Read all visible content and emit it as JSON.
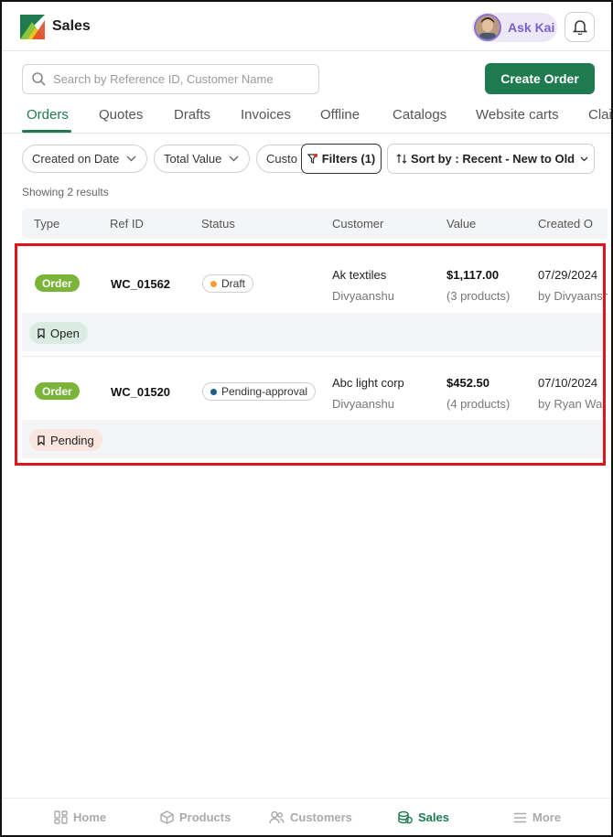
{
  "header": {
    "app_title": "Sales",
    "ask_label": "Ask Kai"
  },
  "search": {
    "placeholder": "Search by Reference ID, Customer Name"
  },
  "create_order_label": "Create Order",
  "tabs": [
    {
      "label": "Orders",
      "active": true
    },
    {
      "label": "Quotes"
    },
    {
      "label": "Drafts"
    },
    {
      "label": "Invoices"
    },
    {
      "label": "Offline"
    },
    {
      "label": "Catalogs"
    },
    {
      "label": "Website carts"
    },
    {
      "label": "Clai"
    }
  ],
  "filters": {
    "created_on_date": "Created on Date",
    "total_value": "Total Value",
    "customer": "Custo",
    "filters_button": "Filters (1)",
    "sort_button": "Sort by : Recent - New to Old"
  },
  "showing": "Showing 2 results",
  "table": {
    "headers": [
      "Type",
      "Ref ID",
      "Status",
      "Customer",
      "Value",
      "Created O"
    ],
    "rows": [
      {
        "type": "Order",
        "ref_id": "WC_01562",
        "status": "Draft",
        "customer": "Ak textiles",
        "customer_by": "Divyaanshu",
        "value": "$1,117.00",
        "products": "(3 products)",
        "created": "07/29/2024",
        "created_by": "by Divyaanshu",
        "sub_status": "Open"
      },
      {
        "type": "Order",
        "ref_id": "WC_01520",
        "status": "Pending-approval",
        "customer": "Abc light corp",
        "customer_by": "Divyaanshu",
        "value": "$452.50",
        "products": "(4 products)",
        "created": "07/10/2024",
        "created_by": "by Ryan Wa",
        "sub_status": "Pending"
      }
    ]
  },
  "bottom_nav": {
    "home": "Home",
    "products": "Products",
    "customers": "Customers",
    "sales": "Sales",
    "more": "More"
  },
  "colors": {
    "brand_green": "#1e7a4f",
    "order_badge": "#7ab53a",
    "draft_dot": "#f0a030",
    "pending_dot": "#1a5f8a",
    "open_badge": "#d9ebe2",
    "pending_badge": "#fbe6df",
    "highlight": "#e0141c"
  }
}
